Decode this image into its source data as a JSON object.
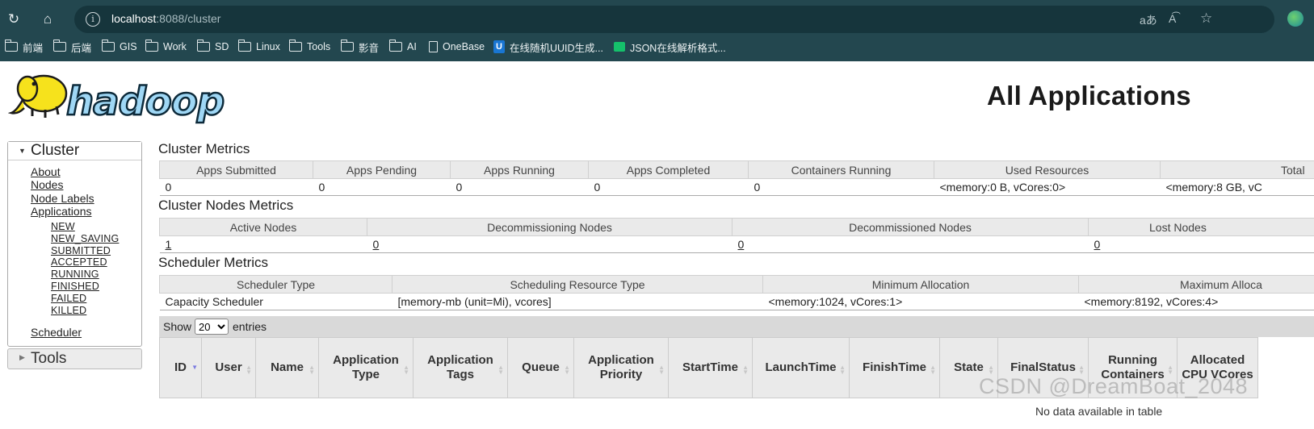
{
  "browser": {
    "url_host": "localhost",
    "url_rest": ":8088/cluster",
    "bookmarks": [
      {
        "label": "前端",
        "kind": "folder"
      },
      {
        "label": "后端",
        "kind": "folder"
      },
      {
        "label": "GIS",
        "kind": "folder"
      },
      {
        "label": "Work",
        "kind": "folder"
      },
      {
        "label": "SD",
        "kind": "folder"
      },
      {
        "label": "Linux",
        "kind": "folder"
      },
      {
        "label": "Tools",
        "kind": "folder"
      },
      {
        "label": "影音",
        "kind": "folder"
      },
      {
        "label": "AI",
        "kind": "folder"
      },
      {
        "label": "OneBase",
        "kind": "page"
      },
      {
        "label": "在线随机UUID生成...",
        "kind": "uuid"
      },
      {
        "label": "JSON在线解析格式...",
        "kind": "json"
      }
    ]
  },
  "header": {
    "logo_text": "hadoop",
    "page_title": "All Applications"
  },
  "sidebar": {
    "cluster_label": "Cluster",
    "links": [
      "About",
      "Nodes",
      "Node Labels",
      "Applications"
    ],
    "app_states": [
      "NEW",
      "NEW_SAVING",
      "SUBMITTED",
      "ACCEPTED",
      "RUNNING",
      "FINISHED",
      "FAILED",
      "KILLED"
    ],
    "scheduler_link": "Scheduler",
    "tools_label": "Tools"
  },
  "cluster_metrics": {
    "title": "Cluster Metrics",
    "headers": [
      "Apps Submitted",
      "Apps Pending",
      "Apps Running",
      "Apps Completed",
      "Containers Running",
      "Used Resources",
      "Total"
    ],
    "values": [
      "0",
      "0",
      "0",
      "0",
      "0",
      "<memory:0 B, vCores:0>",
      "<memory:8 GB, vC"
    ]
  },
  "nodes_metrics": {
    "title": "Cluster Nodes Metrics",
    "headers": [
      "Active Nodes",
      "Decommissioning Nodes",
      "Decommissioned Nodes",
      "Lost Nodes"
    ],
    "values": [
      "1",
      "0",
      "0",
      "0"
    ]
  },
  "scheduler_metrics": {
    "title": "Scheduler Metrics",
    "headers": [
      "Scheduler Type",
      "Scheduling Resource Type",
      "Minimum Allocation",
      "Maximum Alloca"
    ],
    "values": [
      "Capacity Scheduler",
      "[memory-mb (unit=Mi), vcores]",
      "<memory:1024, vCores:1>",
      "<memory:8192, vCores:4>"
    ]
  },
  "apps_table": {
    "show_label": "Show",
    "page_size": "20",
    "entries_label": "entries",
    "columns": [
      "ID",
      "User",
      "Name",
      "Application Type",
      "Application Tags",
      "Queue",
      "Application Priority",
      "StartTime",
      "LaunchTime",
      "FinishTime",
      "State",
      "FinalStatus",
      "Running Containers",
      "Allocated CPU VCores"
    ],
    "empty_message": "No data available in table"
  },
  "watermark": "CSDN @DreamBoat_2048"
}
